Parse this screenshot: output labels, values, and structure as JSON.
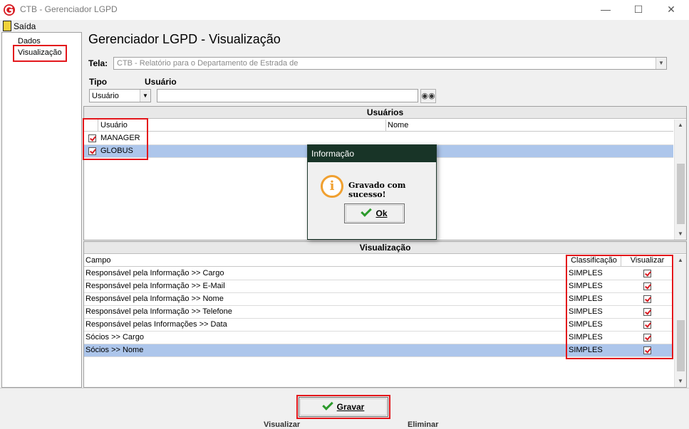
{
  "window": {
    "title": "CTB - Gerenciador LGPD"
  },
  "menu": {
    "exit_label": "Saída"
  },
  "tree": {
    "items": [
      {
        "label": "Dados"
      },
      {
        "label": "Visualização"
      }
    ]
  },
  "main": {
    "title": "Gerenciador LGPD - Visualização",
    "tela_label": "Tela:",
    "tela_value": "CTB - Relatório para o Departamento de Estrada de",
    "tipo_label": "Tipo",
    "usuario_label": "Usuário",
    "tipo_value": "Usuário",
    "usuario_search_value": ""
  },
  "users_panel": {
    "title": "Usuários",
    "columns": [
      "Usuário",
      "Nome"
    ],
    "rows": [
      {
        "user": "MANAGER",
        "name": "",
        "checked": true,
        "selected": false
      },
      {
        "user": "GLOBUS",
        "name": "",
        "checked": true,
        "selected": true
      }
    ]
  },
  "view_panel": {
    "title": "Visualização",
    "columns": [
      "Campo",
      "Classificação",
      "Visualizar"
    ],
    "rows": [
      {
        "campo": "Responsável pela Informação >> Cargo",
        "class": "SIMPLES",
        "visualizar": true
      },
      {
        "campo": "Responsável pela Informação >> E-Mail",
        "class": "SIMPLES",
        "visualizar": true
      },
      {
        "campo": "Responsável pela Informação >> Nome",
        "class": "SIMPLES",
        "visualizar": true
      },
      {
        "campo": "Responsável pela Informação >> Telefone",
        "class": "SIMPLES",
        "visualizar": true
      },
      {
        "campo": "Responsável pelas Informações >> Data",
        "class": "SIMPLES",
        "visualizar": true
      },
      {
        "campo": "Sócios >> Cargo",
        "class": "SIMPLES",
        "visualizar": true
      },
      {
        "campo": "Sócios >> Nome",
        "class": "SIMPLES",
        "visualizar": true
      }
    ]
  },
  "dialog": {
    "title": "Informação",
    "message": "Gravado com sucesso!",
    "ok_label": "Ok"
  },
  "footer": {
    "save_label": "Gravar",
    "partial_left": "Visualizar",
    "partial_right": "Eliminar"
  },
  "colors": {
    "highlight_red": "#e3161b",
    "selection": "#adc6eb",
    "dialog_title": "#183427"
  }
}
